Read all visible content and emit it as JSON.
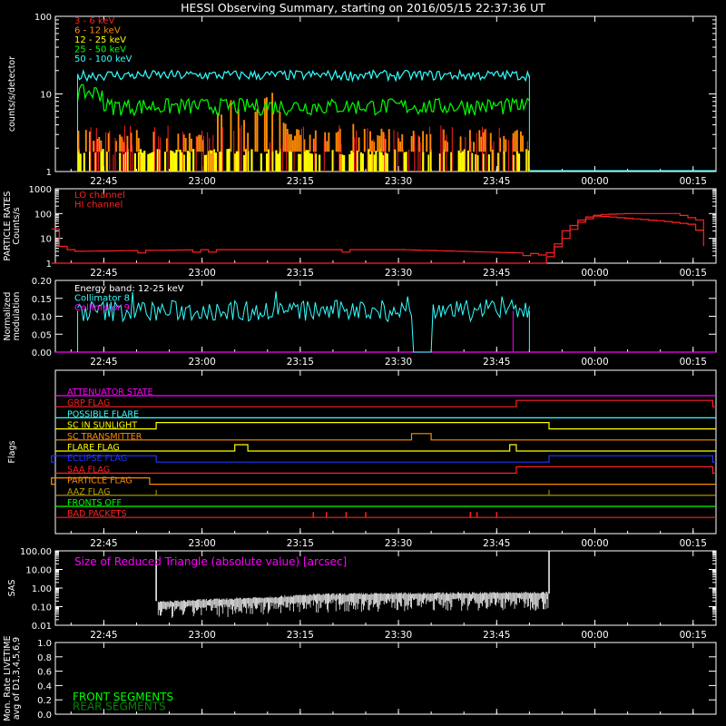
{
  "title": "HESSI Observing Summary, starting on 2016/05/15 22:37:36 UT",
  "colors": {
    "background": "#000000",
    "axes": "#ffffff",
    "red": "#ff2020",
    "orange": "#ff8c00",
    "yellow": "#ffff00",
    "green": "#00ff00",
    "cyan": "#33ffff",
    "magenta": "#ff00ff",
    "blue": "#2233ff",
    "olive": "#b8a000",
    "white": "#ffffff"
  },
  "time_axis": {
    "tick_labels": [
      "22:45",
      "23:00",
      "23:15",
      "23:30",
      "23:45",
      "00:00",
      "00:15"
    ]
  },
  "chart_data": [
    {
      "type": "line",
      "ylabel": "counts/s/detector",
      "y_scale": "log",
      "ylim": [
        1,
        100
      ],
      "y_tick_labels": [
        "1",
        "10",
        "100"
      ],
      "legend_placement": "top-left",
      "data_interval": [
        "22:41",
        "23:50"
      ],
      "series": [
        {
          "name": "3 - 6 keV",
          "color": "#ff2020",
          "level": 2.0,
          "style": "bars"
        },
        {
          "name": "6 - 12 keV",
          "color": "#ff8c00",
          "level": 3.0,
          "style": "bars"
        },
        {
          "name": "12 - 25 keV",
          "color": "#ffff00",
          "level": 1.8,
          "style": "bars"
        },
        {
          "name": "25 - 50 keV",
          "color": "#00ff00",
          "level": 7.0,
          "style": "noisy"
        },
        {
          "name": "50 - 100 keV",
          "color": "#33ffff",
          "level": 17.5,
          "style": "noisy"
        }
      ],
      "peaks": [
        {
          "time": "23:04",
          "value": 9
        },
        {
          "time": "23:10",
          "value": 11
        },
        {
          "time": "23:22",
          "value": 5
        }
      ]
    },
    {
      "type": "line",
      "ylabel": "PARTICLE RATES Counts/s",
      "y_scale": "log",
      "ylim": [
        1,
        1000
      ],
      "y_tick_labels": [
        "1",
        "10",
        "100",
        "1000"
      ],
      "legend_placement": "top-left",
      "series": [
        {
          "name": "LO channel",
          "color": "#ff2020"
        },
        {
          "name": "HI channel",
          "color": "#ff2020"
        }
      ],
      "lo_channel": [
        {
          "t": "22:37",
          "v": 30
        },
        {
          "t": "22:38",
          "v": 5
        },
        {
          "t": "22:40",
          "v": 3
        },
        {
          "t": "23:00",
          "v": 3.5
        },
        {
          "t": "23:30",
          "v": 3.5
        },
        {
          "t": "23:50",
          "v": 2.5
        },
        {
          "t": "23:52",
          "v": 2
        },
        {
          "t": "23:54",
          "v": 5
        },
        {
          "t": "23:57",
          "v": 40
        },
        {
          "t": "00:00",
          "v": 90
        },
        {
          "t": "00:05",
          "v": 100
        },
        {
          "t": "00:12",
          "v": 100
        },
        {
          "t": "00:16",
          "v": 50
        },
        {
          "t": "00:17",
          "v": 10
        }
      ],
      "hi_channel": [
        {
          "t": "22:37",
          "v": 1
        },
        {
          "t": "23:52",
          "v": 1
        },
        {
          "t": "23:55",
          "v": 20
        },
        {
          "t": "23:58",
          "v": 70
        },
        {
          "t": "00:00",
          "v": 80
        },
        {
          "t": "00:10",
          "v": 50
        },
        {
          "t": "00:15",
          "v": 35
        },
        {
          "t": "00:17",
          "v": 3
        }
      ]
    },
    {
      "type": "line",
      "ylabel": "Normalized modulation",
      "ylim": [
        0,
        0.2
      ],
      "y_tick_labels": [
        "0.00",
        "0.05",
        "0.10",
        "0.15",
        "0.20"
      ],
      "legend_placement": "top-left",
      "legend": [
        {
          "text": "Energy band: 12-25 keV",
          "color": "#ffffff"
        },
        {
          "text": "Collimator 8",
          "color": "#33ffff"
        },
        {
          "text": "Collimator 9",
          "color": "#ff00ff"
        }
      ],
      "data_interval": [
        "22:41",
        "23:50"
      ],
      "mean_level": 0.115,
      "gaps": [
        [
          "23:32",
          "23:35"
        ]
      ]
    },
    {
      "type": "table",
      "ylabel": "Flags",
      "flags": [
        {
          "label": "ATTENUATOR STATE",
          "color": "#ff00ff",
          "on": []
        },
        {
          "label": "GRP FLAG",
          "color": "#ff2020",
          "on": [
            [
              "23:48",
              "00:18"
            ]
          ]
        },
        {
          "label": "POSSIBLE FLARE",
          "color": "#33ffff",
          "on": []
        },
        {
          "label": "SC IN SUNLIGHT",
          "color": "#ffff00",
          "on": [
            [
              "22:53",
              "23:53"
            ]
          ]
        },
        {
          "label": "SC TRANSMITTER",
          "color": "#ff8c00",
          "on": [
            [
              "23:32",
              "23:35"
            ]
          ]
        },
        {
          "label": "FLARE FLAG",
          "color": "#ffff00",
          "on": [
            [
              "23:05",
              "23:07"
            ],
            [
              "23:47",
              "23:48"
            ]
          ]
        },
        {
          "label": "ECLIPSE FLAG",
          "color": "#2233ff",
          "on": [
            [
              "22:37",
              "22:53"
            ],
            [
              "23:53",
              "00:18"
            ]
          ]
        },
        {
          "label": "SAA FLAG",
          "color": "#ff2020",
          "on": [
            [
              "23:48",
              "00:18"
            ]
          ]
        },
        {
          "label": "PARTICLE FLAG",
          "color": "#ff8c00",
          "on": [
            [
              "22:37",
              "22:52"
            ]
          ]
        },
        {
          "label": "AAZ FLAG",
          "color": "#b8a000",
          "on": []
        },
        {
          "label": "FRONTS OFF",
          "color": "#00ff00",
          "on": []
        },
        {
          "label": "BAD PACKETS",
          "color": "#ff2020",
          "on": []
        }
      ],
      "bad_packet_times": [
        "23:17",
        "23:19",
        "23:22",
        "23:25",
        "23:41",
        "23:41",
        "23:42",
        "23:45"
      ]
    },
    {
      "type": "line",
      "ylabel": "SAS",
      "y_scale": "log",
      "ylim": [
        0.01,
        100
      ],
      "y_tick_labels": [
        "0.01",
        "0.10",
        "1.00",
        "10.00",
        "100.00"
      ],
      "annotation": "Size of Reduced Triangle (absolute value) [arcsec]",
      "annotation_color": "#ff00ff",
      "data_interval": [
        "22:53",
        "23:53"
      ],
      "trend": [
        {
          "t": "22:53",
          "v": 0.15
        },
        {
          "t": "23:00",
          "v": 0.2
        },
        {
          "t": "23:10",
          "v": 0.28
        },
        {
          "t": "23:18",
          "v": 0.4
        },
        {
          "t": "23:30",
          "v": 0.45
        },
        {
          "t": "23:53",
          "v": 0.5
        }
      ]
    },
    {
      "type": "line",
      "ylabel": "Mon. Rate LIVETIME avg of D1,3,4,5,6,9",
      "ylim": [
        0,
        1
      ],
      "y_tick_labels": [
        "0.0",
        "0.2",
        "0.4",
        "0.6",
        "0.8",
        "1.0"
      ],
      "legend_placement": "bottom-left",
      "series": [
        {
          "name": "FRONT SEGMENTS",
          "color": "#00ff00",
          "values": []
        },
        {
          "name": "REAR SEGMENTS",
          "color": "#008800",
          "values": []
        }
      ]
    }
  ]
}
